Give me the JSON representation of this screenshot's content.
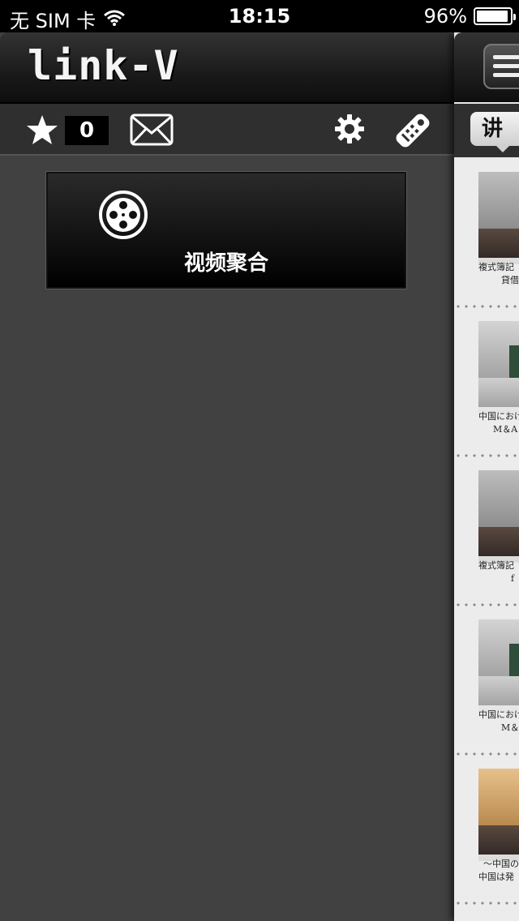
{
  "status_bar": {
    "carrier": "无 SIM 卡",
    "time": "18:15",
    "battery_percent_label": "96%",
    "battery_level": 0.96,
    "wifi_icon": "wifi-icon",
    "battery_icon": "battery-icon"
  },
  "menu": {
    "logo": "link-V",
    "toolbar": {
      "favorites_icon": "star-icon",
      "favorites_count": "0",
      "mail_icon": "mail-icon",
      "settings_icon": "gear-icon",
      "remote_icon": "remote-control-icon"
    },
    "tiles": [
      {
        "label": "视频聚合",
        "icon": "film-reel-icon"
      }
    ]
  },
  "content": {
    "menu_button_icon": "hamburger-menu-icon",
    "tab_label": "讲",
    "items": [
      {
        "caption_line1": "複式簿記",
        "caption_line2": "貸借"
      },
      {
        "caption_line1": "中国におけ",
        "caption_line2": "M＆A"
      },
      {
        "caption_line1": "複式簿記",
        "caption_line2": "f"
      },
      {
        "caption_line1": "中国におけ",
        "caption_line2": "M＆"
      },
      {
        "caption_line1": "～中国の",
        "caption_line2": "中国は発"
      }
    ]
  }
}
